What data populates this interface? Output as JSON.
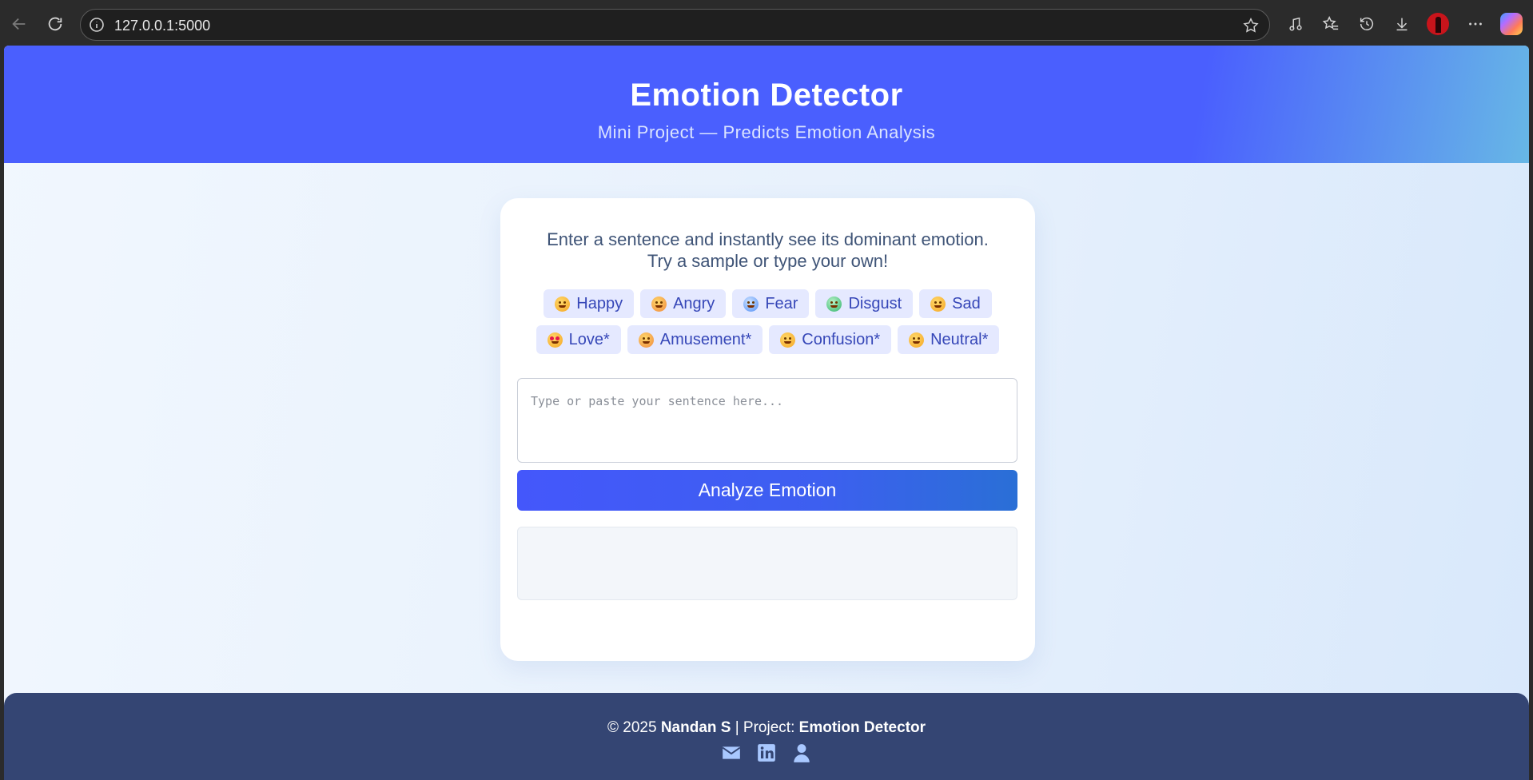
{
  "browser": {
    "url": "127.0.0.1:5000"
  },
  "header": {
    "title": "Emotion Detector",
    "subtitle": "Mini Project — Predicts Emotion Analysis"
  },
  "card": {
    "intro_line1": "Enter a sentence and instantly see its dominant emotion.",
    "intro_line2": "Try a sample or type your own!",
    "samples_row1": [
      {
        "label": "Happy",
        "icon": "grinning-face-icon"
      },
      {
        "label": "Angry",
        "icon": "angry-face-icon"
      },
      {
        "label": "Fear",
        "icon": "fearful-face-icon"
      },
      {
        "label": "Disgust",
        "icon": "nauseated-face-icon"
      },
      {
        "label": "Sad",
        "icon": "sad-face-icon"
      }
    ],
    "samples_row2": [
      {
        "label": "Love*",
        "icon": "heart-eyes-face-icon"
      },
      {
        "label": "Amusement*",
        "icon": "laughing-face-icon"
      },
      {
        "label": "Confusion*",
        "icon": "confused-face-icon"
      },
      {
        "label": "Neutral*",
        "icon": "neutral-face-icon"
      }
    ],
    "input_placeholder": "Type or paste your sentence here...",
    "input_value": "",
    "analyze_label": "Analyze Emotion",
    "result_text": ""
  },
  "footer": {
    "copyright": "© 2025",
    "author": "Nandan S",
    "project_prefix": "| Project:",
    "project_name": "Emotion Detector",
    "social_icons": [
      "mail-icon",
      "linkedin-icon",
      "user-icon"
    ]
  },
  "colors": {
    "header_bg": "#4a5ffe",
    "chip_bg": "#e5e9ff",
    "chip_text": "#3647b8",
    "button_bg": "#4457fb",
    "footer_bg": "#344573"
  }
}
